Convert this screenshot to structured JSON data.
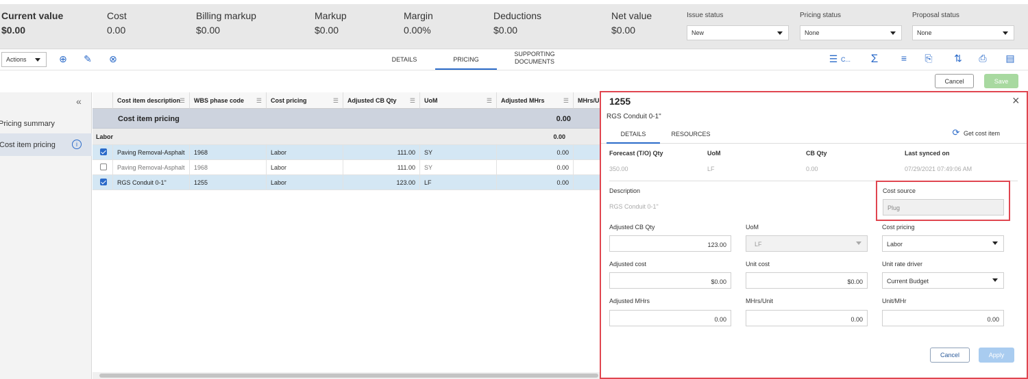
{
  "summary": {
    "current_value_label": "Current value",
    "current_value": "$0.00",
    "cost_label": "Cost",
    "cost": "0.00",
    "billing_markup_label": "Billing markup",
    "billing_markup": "$0.00",
    "markup_label": "Markup",
    "markup": "$0.00",
    "margin_label": "Margin",
    "margin": "0.00%",
    "deductions_label": "Deductions",
    "deductions": "$0.00",
    "net_value_label": "Net value",
    "net_value": "$0.00",
    "issue_status_label": "Issue status",
    "issue_status": "New",
    "pricing_status_label": "Pricing status",
    "pricing_status": "None",
    "proposal_status_label": "Proposal status",
    "proposal_status": "None"
  },
  "toolbar": {
    "actions_label": "Actions",
    "tabs": [
      "DETAILS",
      "PRICING",
      "SUPPORTING DOCUMENTS"
    ],
    "active_tab": "PRICING",
    "columns_short": "C...",
    "cancel_label": "Cancel",
    "save_label": "Save"
  },
  "leftnav": {
    "items": [
      {
        "label": "Pricing summary",
        "active": false
      },
      {
        "label": "Cost item pricing",
        "active": true
      }
    ]
  },
  "grid": {
    "columns": [
      "Cost item description",
      "WBS phase code",
      "Cost pricing",
      "Adjusted CB Qty",
      "UoM",
      "Adjusted MHrs",
      "MHrs/U"
    ],
    "section_title": "Cost item pricing",
    "section_total": "0.00",
    "group_label": "Labor",
    "group_total": "0.00",
    "rows": [
      {
        "checked": true,
        "description": "Paving Removal-Asphalt",
        "wbs": "1968",
        "pricing": "Labor",
        "qty": "111.00",
        "uom": "SY",
        "mhrs": "0.00"
      },
      {
        "checked": false,
        "description": "Paving Removal-Asphalt",
        "wbs": "1968",
        "pricing": "Labor",
        "qty": "111.00",
        "uom": "SY",
        "mhrs": "0.00"
      },
      {
        "checked": true,
        "description": "RGS Conduit 0-1\"",
        "wbs": "1255",
        "pricing": "Labor",
        "qty": "123.00",
        "uom": "LF",
        "mhrs": "0.00"
      }
    ]
  },
  "panel": {
    "title": "1255",
    "subtitle": "RGS Conduit 0-1\"",
    "tabs": [
      "DETAILS",
      "RESOURCES"
    ],
    "get_cost_item_label": "Get cost item",
    "info": {
      "forecast_label": "Forecast (T/O) Qty",
      "forecast": "350.00",
      "uom_label": "UoM",
      "uom": "LF",
      "cbqty_label": "CB Qty",
      "cbqty": "0.00",
      "synced_label": "Last synced on",
      "synced": "07/29/2021 07:49:06 AM"
    },
    "description_label": "Description",
    "description": "RGS Conduit 0-1\"",
    "cost_source_label": "Cost source",
    "cost_source": "Plug",
    "adjusted_cb_qty_label": "Adjusted CB Qty",
    "adjusted_cb_qty": "123.00",
    "uom_label": "UoM",
    "uom": "LF",
    "cost_pricing_label": "Cost pricing",
    "cost_pricing": "Labor",
    "adjusted_cost_label": "Adjusted cost",
    "adjusted_cost": "$0.00",
    "unit_cost_label": "Unit cost",
    "unit_cost": "$0.00",
    "unit_rate_driver_label": "Unit rate driver",
    "unit_rate_driver": "Current Budget",
    "adjusted_mhrs_label": "Adjusted MHrs",
    "adjusted_mhrs": "0.00",
    "mhrs_unit_label": "MHrs/Unit",
    "mhrs_unit": "0.00",
    "unit_mhr_label": "Unit/MHr",
    "unit_mhr": "0.00",
    "cancel_label": "Cancel",
    "apply_label": "Apply"
  },
  "colors": {
    "accent": "#2a6ac9",
    "highlight": "#e0454f",
    "save": "#a8d9a0",
    "apply": "#a9ccf0"
  }
}
